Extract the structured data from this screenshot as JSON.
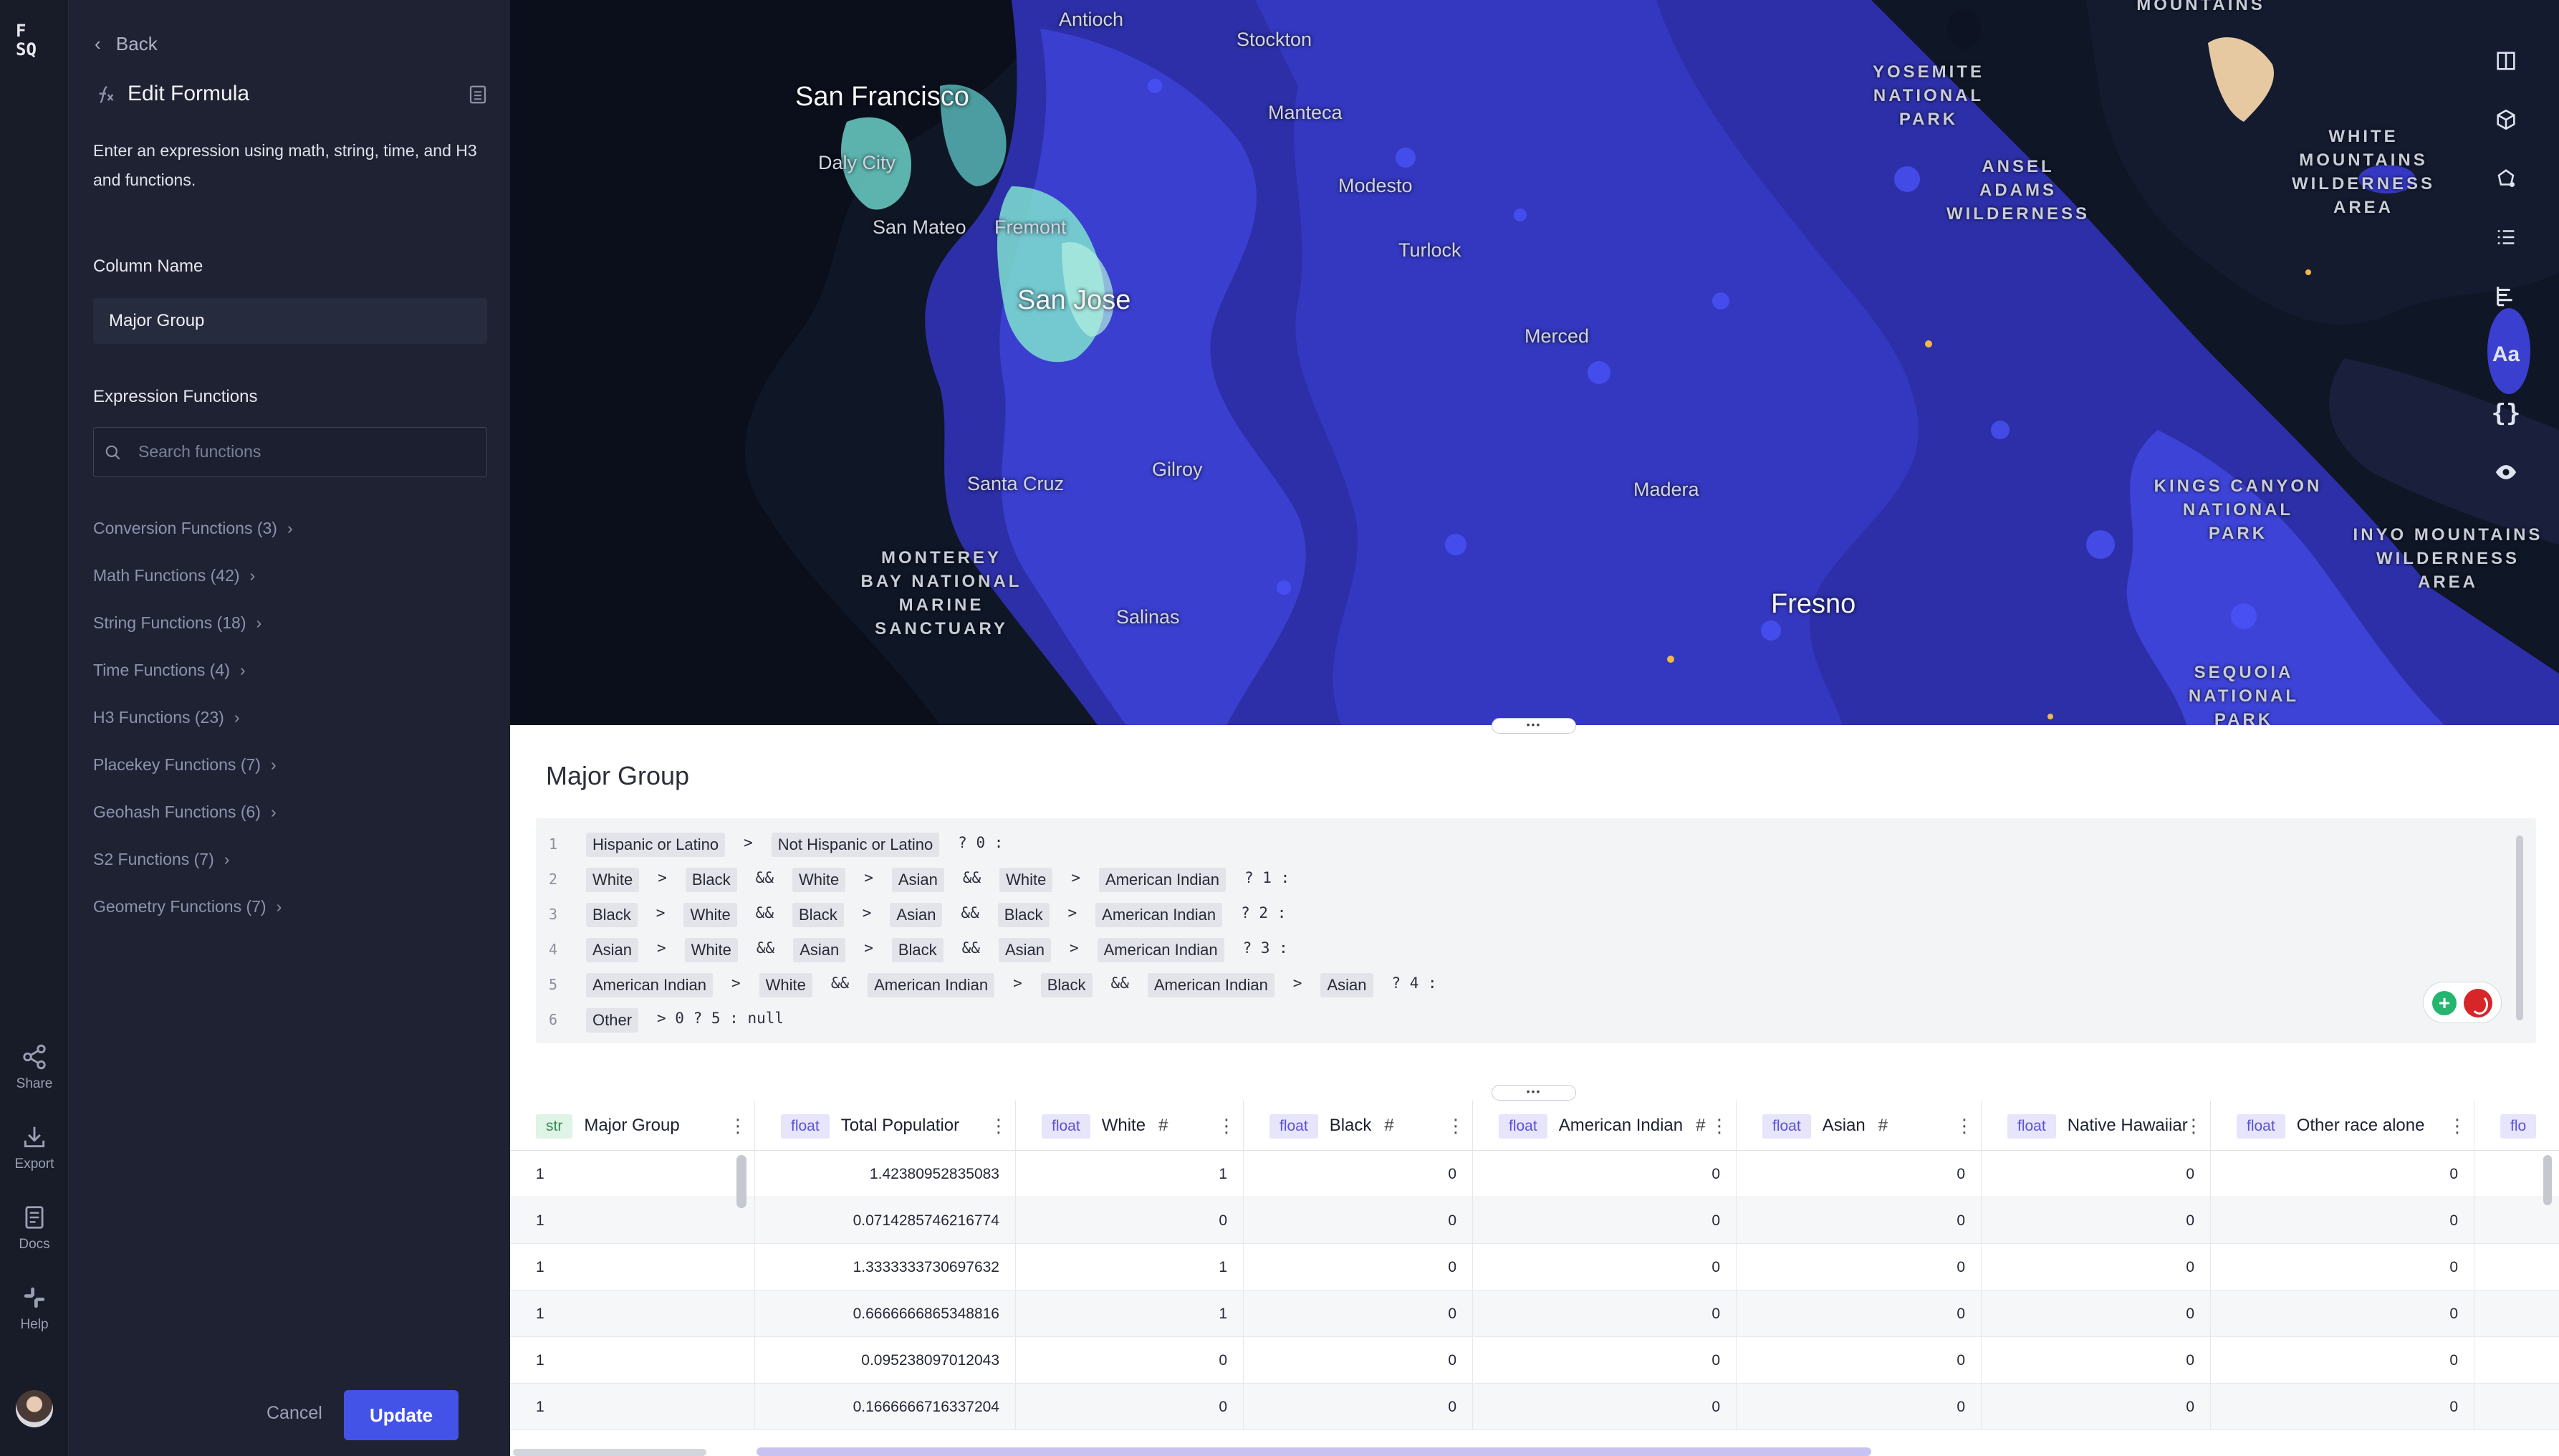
{
  "app": {
    "logo": "F\nSQ"
  },
  "rail": {
    "share": "Share",
    "export": "Export",
    "docs": "Docs",
    "help": "Help"
  },
  "panel": {
    "back": "Back",
    "title": "Edit Formula",
    "description": "Enter an expression using math, string, time, and H3 and functions.",
    "column_name_label": "Column Name",
    "column_name_value": "Major Group",
    "expression_functions_label": "Expression Functions",
    "search_placeholder": "Search functions",
    "categories": [
      "Conversion Functions (3)",
      "Math Functions (42)",
      "String Functions (18)",
      "Time Functions (4)",
      "H3 Functions (23)",
      "Placekey Functions (7)",
      "Geohash Functions (6)",
      "S2 Functions (7)",
      "Geometry Functions (7)"
    ],
    "cancel": "Cancel",
    "update": "Update"
  },
  "map": {
    "cities": [
      "San Francisco",
      "San Jose",
      "Fresno"
    ],
    "towns": [
      "Antioch",
      "Stockton",
      "Manteca",
      "Daly City",
      "San Mateo",
      "Fremont",
      "Modesto",
      "Turlock",
      "Merced",
      "Gilroy",
      "Santa Cruz",
      "Madera",
      "Salinas"
    ],
    "parks": [
      "YOSEMITE\nNATIONAL\nPARK",
      "ANSEL\nADAMS\nWILDERNESS",
      "WHITE\nMOUNTAINS\nWILDERNESS\nAREA",
      "MONTEREY\nBAY NATIONAL\nMARINE\nSANCTUARY",
      "KINGS CANYON\nNATIONAL\nPARK",
      "INYO MOUNTAINS\nWILDERNESS\nAREA",
      "SEQUOIA\nNATIONAL\nPARK",
      "MOUNTAINS"
    ],
    "tools": [
      "split-map-icon",
      "3d-cube-icon",
      "draw-polygon-icon",
      "layers-list-icon",
      "legend-icon",
      "Aa",
      "{}",
      "eye-icon"
    ]
  },
  "editor": {
    "title": "Major Group",
    "lines": [
      {
        "n": "1",
        "parts": [
          {
            "t": "chip",
            "v": "Hispanic or Latino"
          },
          {
            "t": "op",
            "v": ">"
          },
          {
            "t": "chip",
            "v": "Not Hispanic or Latino"
          },
          {
            "t": "op",
            "v": "? 0 :"
          }
        ]
      },
      {
        "n": "2",
        "parts": [
          {
            "t": "chip",
            "v": "White"
          },
          {
            "t": "op",
            "v": ">"
          },
          {
            "t": "chip",
            "v": "Black"
          },
          {
            "t": "op",
            "v": "&&"
          },
          {
            "t": "chip",
            "v": "White"
          },
          {
            "t": "op",
            "v": ">"
          },
          {
            "t": "chip",
            "v": "Asian"
          },
          {
            "t": "op",
            "v": "&&"
          },
          {
            "t": "chip",
            "v": "White"
          },
          {
            "t": "op",
            "v": ">"
          },
          {
            "t": "chip",
            "v": "American Indian"
          },
          {
            "t": "op",
            "v": "? 1 :"
          }
        ]
      },
      {
        "n": "3",
        "parts": [
          {
            "t": "chip",
            "v": "Black"
          },
          {
            "t": "op",
            "v": ">"
          },
          {
            "t": "chip",
            "v": "White"
          },
          {
            "t": "op",
            "v": "&&"
          },
          {
            "t": "chip",
            "v": "Black"
          },
          {
            "t": "op",
            "v": ">"
          },
          {
            "t": "chip",
            "v": "Asian"
          },
          {
            "t": "op",
            "v": "&&"
          },
          {
            "t": "chip",
            "v": "Black"
          },
          {
            "t": "op",
            "v": ">"
          },
          {
            "t": "chip",
            "v": "American Indian"
          },
          {
            "t": "op",
            "v": "? 2 :"
          }
        ]
      },
      {
        "n": "4",
        "parts": [
          {
            "t": "chip",
            "v": "Asian"
          },
          {
            "t": "op",
            "v": ">"
          },
          {
            "t": "chip",
            "v": "White"
          },
          {
            "t": "op",
            "v": "&&"
          },
          {
            "t": "chip",
            "v": "Asian"
          },
          {
            "t": "op",
            "v": ">"
          },
          {
            "t": "chip",
            "v": "Black"
          },
          {
            "t": "op",
            "v": "&&"
          },
          {
            "t": "chip",
            "v": "Asian"
          },
          {
            "t": "op",
            "v": ">"
          },
          {
            "t": "chip",
            "v": "American Indian"
          },
          {
            "t": "op",
            "v": "? 3 :"
          }
        ]
      },
      {
        "n": "5",
        "parts": [
          {
            "t": "chip",
            "v": "American Indian"
          },
          {
            "t": "op",
            "v": ">"
          },
          {
            "t": "chip",
            "v": "White"
          },
          {
            "t": "op",
            "v": "&&"
          },
          {
            "t": "chip",
            "v": "American Indian"
          },
          {
            "t": "op",
            "v": ">"
          },
          {
            "t": "chip",
            "v": "Black"
          },
          {
            "t": "op",
            "v": "&&"
          },
          {
            "t": "chip",
            "v": "American Indian"
          },
          {
            "t": "op",
            "v": ">"
          },
          {
            "t": "chip",
            "v": "Asian"
          },
          {
            "t": "op",
            "v": "? 4 :"
          }
        ]
      },
      {
        "n": "6",
        "parts": [
          {
            "t": "chip",
            "v": "Other"
          },
          {
            "t": "op",
            "v": "> 0 ? 5 : null"
          }
        ]
      }
    ]
  },
  "table": {
    "columns": [
      {
        "type": "str",
        "name": "Major Group",
        "hash": false
      },
      {
        "type": "float",
        "name": "Total Populatior",
        "hash": false
      },
      {
        "type": "float",
        "name": "White",
        "hash": true
      },
      {
        "type": "float",
        "name": "Black",
        "hash": true
      },
      {
        "type": "float",
        "name": "American Indian",
        "hash": true
      },
      {
        "type": "float",
        "name": "Asian",
        "hash": true
      },
      {
        "type": "float",
        "name": "Native Hawaiiar",
        "hash": false
      },
      {
        "type": "float",
        "name": "Other race alone",
        "hash": false
      },
      {
        "type": "flo",
        "name": "",
        "hash": false
      }
    ],
    "rows": [
      [
        "1",
        "1.42380952835083",
        "1",
        "0",
        "0",
        "0",
        "0",
        "0"
      ],
      [
        "1",
        "0.0714285746216774",
        "0",
        "0",
        "0",
        "0",
        "0",
        "0"
      ],
      [
        "1",
        "1.3333333730697632",
        "1",
        "0",
        "0",
        "0",
        "0",
        "0"
      ],
      [
        "1",
        "0.6666666865348816",
        "1",
        "0",
        "0",
        "0",
        "0",
        "0"
      ],
      [
        "1",
        "0.095238097012043",
        "0",
        "0",
        "0",
        "0",
        "0",
        "0"
      ],
      [
        "1",
        "0.1666666716337204",
        "0",
        "0",
        "0",
        "0",
        "0",
        "0"
      ]
    ]
  }
}
